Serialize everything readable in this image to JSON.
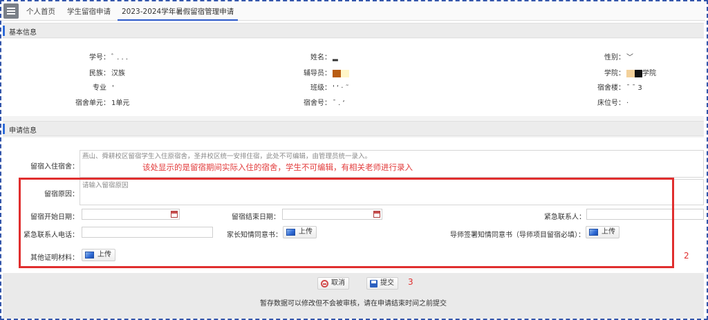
{
  "tabs": [
    {
      "label": "个人首页"
    },
    {
      "label": "学生留宿申请"
    },
    {
      "label": "2023-2024学年暑假留宿管理申请"
    }
  ],
  "basic_section": {
    "title": "基本信息",
    "fields": {
      "student_id": {
        "label": "学号：",
        "value": "ﾞ  . . ."
      },
      "name": {
        "label": "姓名：",
        "value": "▂"
      },
      "gender": {
        "label": "性别：",
        "value": "﹀"
      },
      "ethnicity": {
        "label": "民族：",
        "value": "汉族"
      },
      "counselor": {
        "label": "辅导员：",
        "value": ""
      },
      "college": {
        "label": "学院：",
        "value": "学院"
      },
      "major": {
        "label": "专业",
        "value": "'"
      },
      "class": {
        "label": "班级：",
        "value": "' ‘   ·          ˜"
      },
      "building": {
        "label": "宿舍楼：",
        "value": "ˉ ˉ   3"
      },
      "unit": {
        "label": "宿舍单元：",
        "value": "1单元"
      },
      "room": {
        "label": "宿舍号：",
        "value": "ˉ . ‘"
      },
      "bed": {
        "label": "床位号：",
        "value": "·"
      }
    }
  },
  "apply_section": {
    "title": "申请信息",
    "dorm_label": "留宿入住宿舍：",
    "dorm_note": "燕山、舜耕校区留宿学生入住原宿舍，圣井校区统一安排住宿，此处不可编辑，由管理员统一录入。",
    "annotation_text": "该处显示的是留宿期间实际入住的宿舍，学生不可编辑，有相关老师进行录入",
    "reason_label": "留宿原因：",
    "reason_placeholder": "请输入留宿原因",
    "start_label": "留宿开始日期：",
    "end_label": "留宿结束日期：",
    "contact_label": "紧急联系人：",
    "phone_label": "紧急联系人电话：",
    "parent_consent_label": "家长知情同意书：",
    "tutor_consent_label": "导师签署知情同意书（导师项目留宿必填）：",
    "other_label": "其他证明材料：",
    "upload_label": "上传",
    "box_number": "2"
  },
  "footer": {
    "cancel_label": "取消",
    "submit_label": "提交",
    "submit_number": "3",
    "hint": "暂存数据可以修改但不会被审核，请在申请结束时间之前提交"
  },
  "colors": {
    "accent": "#2a57c8",
    "annotation": "#e02e2e",
    "counselor_mask": "#b85c12",
    "college_mask": "#f3d19b"
  }
}
